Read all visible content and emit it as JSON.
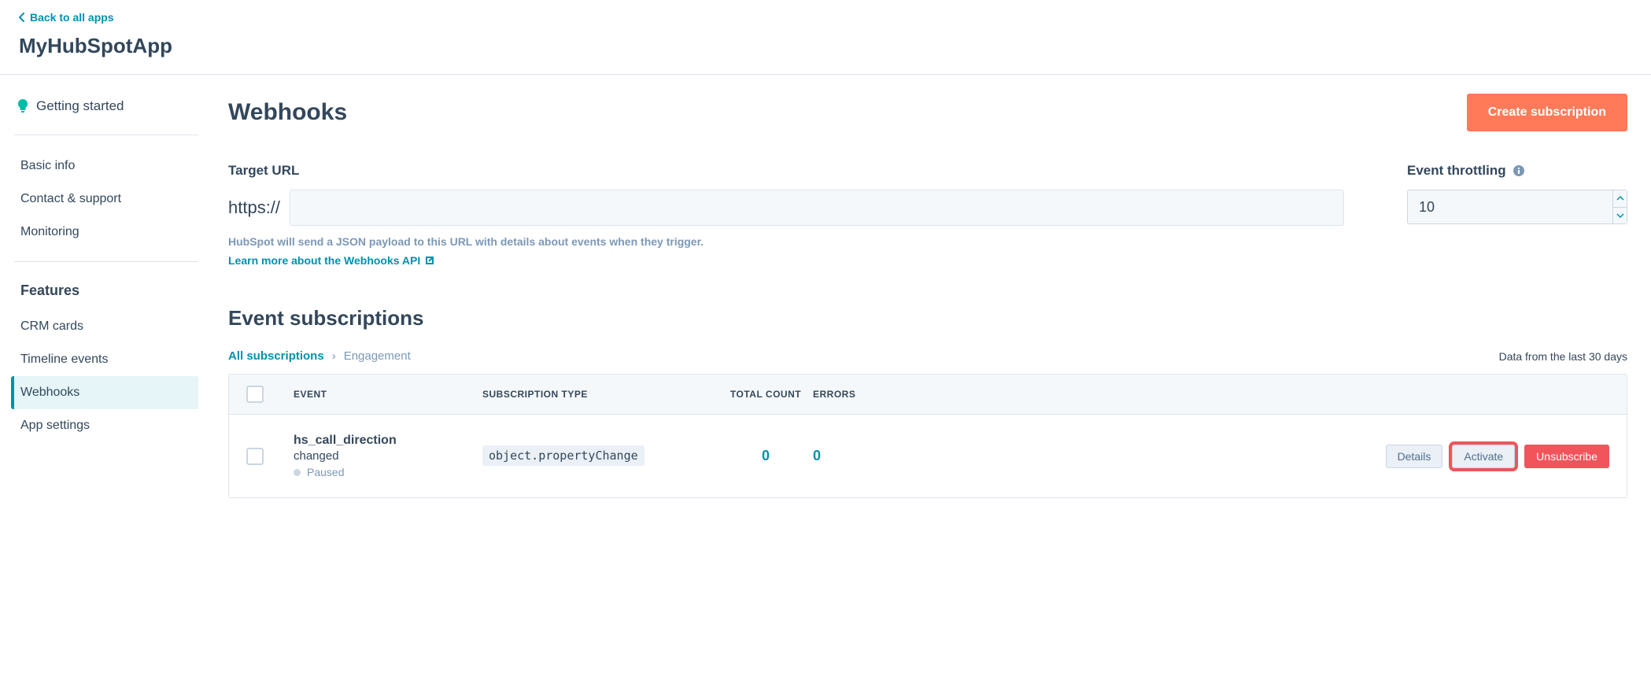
{
  "header": {
    "back_label": "Back to all apps",
    "app_name": "MyHubSpotApp"
  },
  "sidebar": {
    "getting_started": "Getting started",
    "items_top": [
      "Basic info",
      "Contact & support",
      "Monitoring"
    ],
    "features_head": "Features",
    "items_features": [
      "CRM cards",
      "Timeline events",
      "Webhooks",
      "App settings"
    ],
    "active_index": 2
  },
  "page": {
    "title": "Webhooks",
    "create_button": "Create subscription",
    "target_url_label": "Target URL",
    "url_prefix": "https://",
    "helper_text": "HubSpot will send a JSON payload to this URL with details about events when they trigger.",
    "learn_link": "Learn more about the Webhooks API",
    "throttle_label": "Event throttling",
    "throttle_value": "10"
  },
  "subscriptions": {
    "section_title": "Event subscriptions",
    "crumb_root": "All subscriptions",
    "crumb_current": "Engagement",
    "data_range": "Data from the last 30 days",
    "columns": {
      "event": "EVENT",
      "type": "SUBSCRIPTION TYPE",
      "count": "TOTAL COUNT",
      "errors": "ERRORS"
    },
    "row": {
      "event_name": "hs_call_direction",
      "event_sub": "changed",
      "status": "Paused",
      "type_code": "object.propertyChange",
      "count": "0",
      "errors": "0",
      "btn_details": "Details",
      "btn_activate": "Activate",
      "btn_unsubscribe": "Unsubscribe"
    }
  }
}
